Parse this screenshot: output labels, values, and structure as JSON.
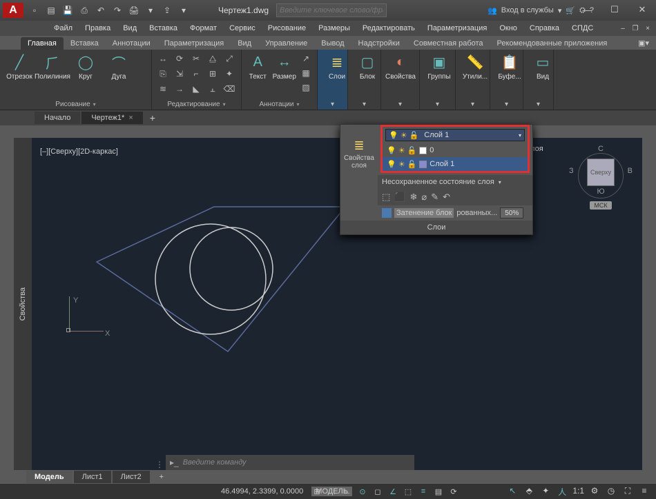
{
  "title": "Чертеж1.dwg",
  "search_placeholder": "Введите ключевое слово/фразу",
  "signin": "Вход в службы",
  "menu": [
    "Файл",
    "Правка",
    "Вид",
    "Вставка",
    "Формат",
    "Сервис",
    "Рисование",
    "Размеры",
    "Редактировать",
    "Параметризация",
    "Окно",
    "Справка",
    "СПДС"
  ],
  "ribbon_tabs": [
    "Главная",
    "Вставка",
    "Аннотации",
    "Параметризация",
    "Вид",
    "Управление",
    "Вывод",
    "Надстройки",
    "Совместная работа",
    "Рекомендованные приложения"
  ],
  "ribbon": {
    "draw": {
      "items": [
        "Отрезок",
        "Полилиния",
        "Круг",
        "Дуга"
      ],
      "title": "Рисование"
    },
    "edit": {
      "title": "Редактирование"
    },
    "annot": {
      "items": [
        "Текст",
        "Размер"
      ],
      "title": "Аннотации"
    },
    "layers": {
      "title": "Слои",
      "btn": "Слои",
      "props": "Свойства слоя"
    },
    "block": {
      "title": "Блок",
      "btn": "Блок"
    },
    "props": {
      "title": "Свойства",
      "btn": "Свойства"
    },
    "groups": {
      "title": "Группы",
      "btn": "Группы"
    },
    "util": {
      "title": "Утилиты",
      "btn": "Утили..."
    },
    "clip": {
      "title": "Буфе...",
      "btn": "Буфе..."
    },
    "view": {
      "title": "Вид",
      "btn": "Вид"
    }
  },
  "file_tabs": {
    "start": "Начало",
    "current": "Чертеж1*"
  },
  "view_label": "[–][Сверху][2D-каркас]",
  "layer_panel": {
    "side_label": "Свойства слоя",
    "right_label": "...ства слоя",
    "current": "Слой 1",
    "rows": [
      {
        "name": "0",
        "color": "#ffffff"
      },
      {
        "name": "Слой 1",
        "color": "#8a8ad0"
      }
    ],
    "state": "Несохраненное состояние слоя",
    "block_label": "Затенение блок",
    "block_label2": "рованных...",
    "block_alpha": "50%",
    "footer": "Слои"
  },
  "viewcube": {
    "n": "С",
    "s": "Ю",
    "e": "В",
    "w": "З",
    "face": "Сверху",
    "msk": "МСК"
  },
  "ucs": {
    "x": "X",
    "y": "Y"
  },
  "cmd_placeholder": "Введите команду",
  "bottom_tabs": [
    "Модель",
    "Лист1",
    "Лист2"
  ],
  "status": {
    "coords": "46.4994, 2.3399, 0.0000",
    "mode": "МОДЕЛЬ",
    "scale": "1:1"
  }
}
